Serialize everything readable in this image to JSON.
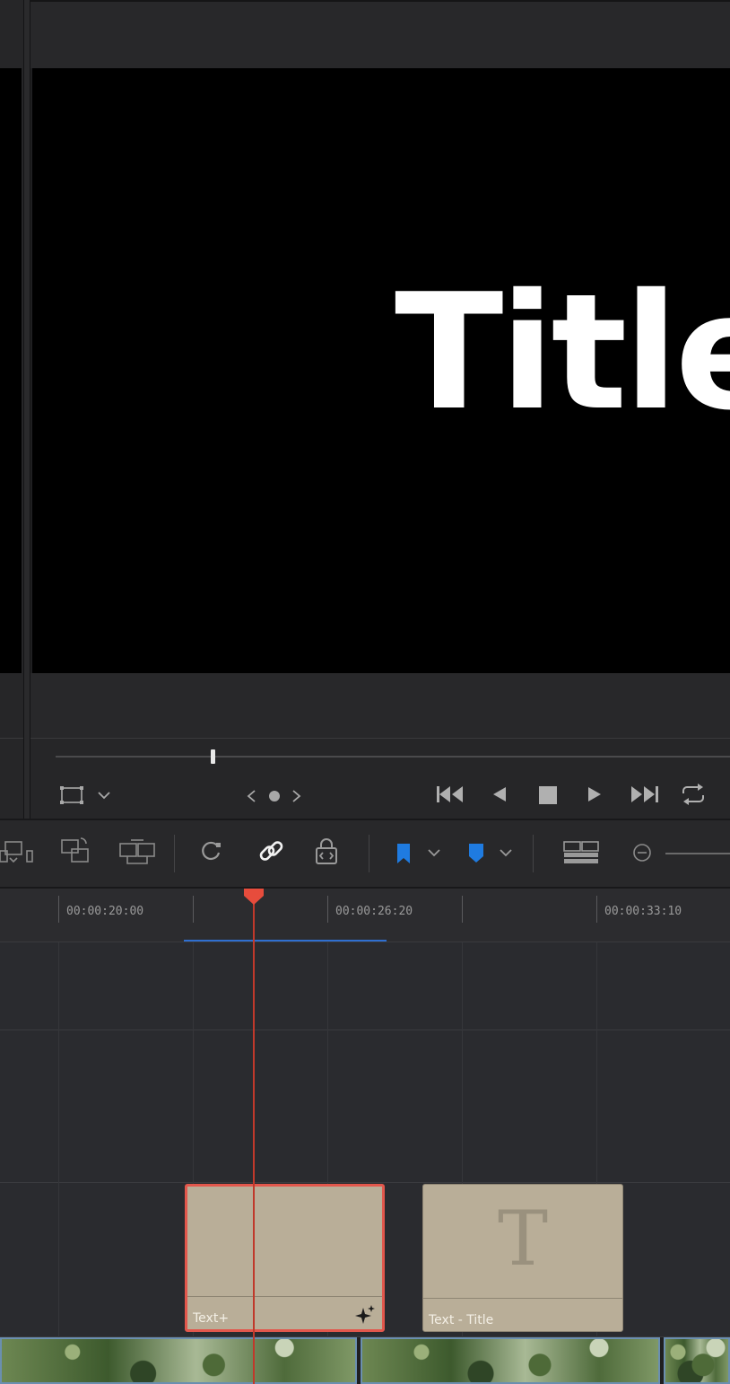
{
  "viewer": {
    "preview_text": "Title"
  },
  "timeline": {
    "timecodes": [
      "00:00:20:00",
      "00:00:26:20",
      "00:00:33:10"
    ]
  },
  "clips": {
    "text_plus": {
      "label": "Text+"
    },
    "text_title": {
      "label": "Text - Title",
      "thumbnail_glyph": "T"
    }
  },
  "colors": {
    "playhead": "#e74c3c",
    "selected_clip_border": "#e2574c",
    "flag_blue": "#1f7be0",
    "in_out_range": "#2f6fd0",
    "title_clip_fill": "#b9ae98"
  },
  "icons": [
    "transform-icon",
    "chevron-down-icon",
    "nav-prev-icon",
    "nav-dot-icon",
    "nav-next-icon",
    "skip-to-start-icon",
    "step-back-icon",
    "stop-icon",
    "play-icon",
    "skip-to-end-icon",
    "loop-icon",
    "replace-clip-icon",
    "overwrite-clip-icon",
    "swap-clip-icon",
    "snapping-icon",
    "linked-selection-icon",
    "position-lock-icon",
    "flag-icon",
    "marker-icon",
    "timeline-view-options-icon",
    "zoom-out-icon",
    "effects-sparkle-icon"
  ]
}
